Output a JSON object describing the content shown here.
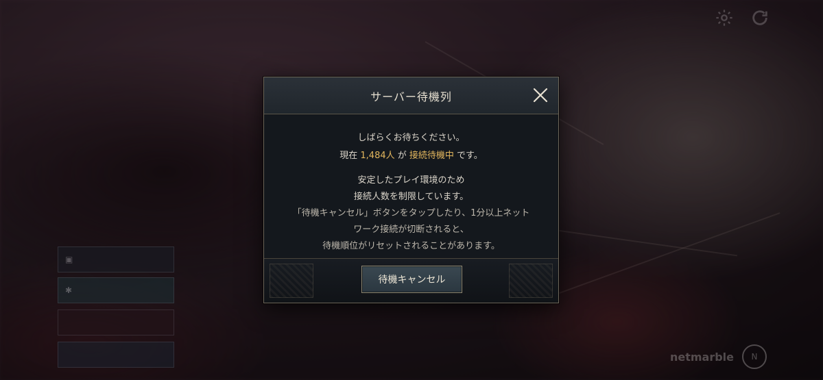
{
  "background": {
    "topleft_lines": [
      "",
      ""
    ],
    "side_note": "",
    "side_buttons": [
      {
        "icon": "login-icon",
        "label_a": "",
        "label_b": ""
      },
      {
        "icon": "gear-icon",
        "label": ""
      },
      {
        "label": ""
      },
      {
        "label": ""
      }
    ],
    "logo": "netmarble"
  },
  "top_icons": {
    "settings": "gear-icon",
    "refresh": "refresh-icon"
  },
  "dialog": {
    "title": "サーバー待機列",
    "close_icon": "close-icon",
    "line1": "しばらくお待ちください。",
    "line2_prefix": "現在 ",
    "line2_count": "1,484人",
    "line2_mid": " が ",
    "line2_status": "接続待機中",
    "line2_suffix": " です。",
    "line3": "安定したプレイ環境のため",
    "line4": "接続人数を制限しています。",
    "line5": "「待機キャンセル」ボタンをタップしたり、1分以上ネット",
    "line6": "ワーク接続が切断されると、",
    "line7": "待機順位がリセットされることがあります。",
    "cancel_button": "待機キャンセル"
  },
  "colors": {
    "accent_gold": "#e2b65e",
    "dialog_bg": "#14181d",
    "border": "#6d6659"
  }
}
